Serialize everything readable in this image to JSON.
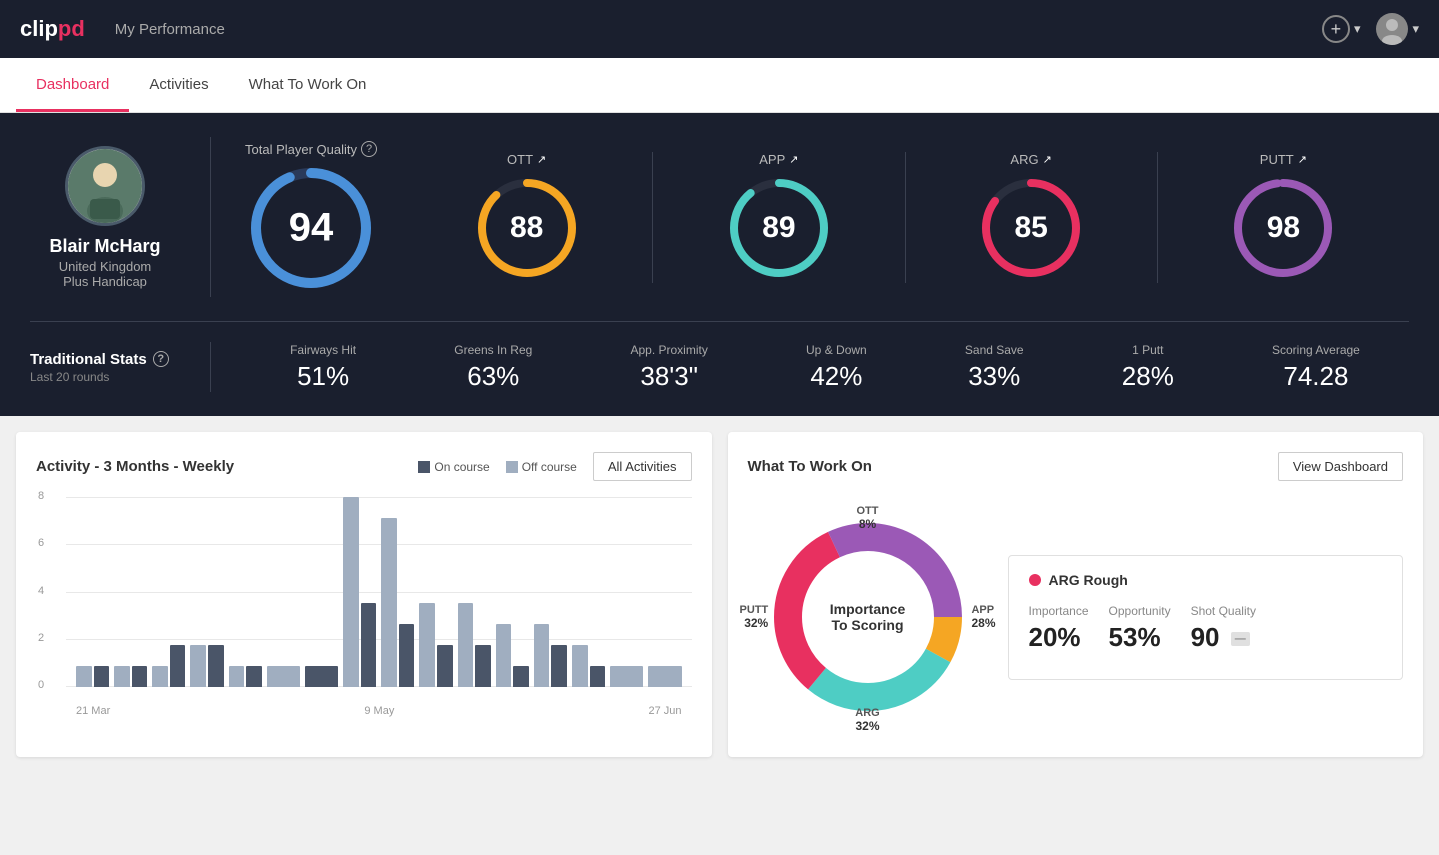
{
  "header": {
    "logo": "clippd",
    "logo_clip": "clip",
    "logo_pd": "pd",
    "title": "My Performance",
    "add_label": "+",
    "chevron": "▾"
  },
  "nav": {
    "tabs": [
      {
        "label": "Dashboard",
        "active": true
      },
      {
        "label": "Activities",
        "active": false
      },
      {
        "label": "What To Work On",
        "active": false
      }
    ]
  },
  "player": {
    "name": "Blair McHarg",
    "country": "United Kingdom",
    "handicap": "Plus Handicap"
  },
  "total_quality": {
    "label": "Total Player Quality",
    "value": 94,
    "pct": 94
  },
  "scores": [
    {
      "label": "OTT",
      "value": 88,
      "pct": 88,
      "color": "#f5a623",
      "track": "#2a2f3e"
    },
    {
      "label": "APP",
      "value": 89,
      "pct": 89,
      "color": "#4ecdc4",
      "track": "#2a2f3e"
    },
    {
      "label": "ARG",
      "value": 85,
      "pct": 85,
      "color": "#e83060",
      "track": "#2a2f3e"
    },
    {
      "label": "PUTT",
      "value": 98,
      "pct": 98,
      "color": "#9b59b6",
      "track": "#2a2f3e"
    }
  ],
  "trad_stats": {
    "title": "Traditional Stats",
    "subtitle": "Last 20 rounds",
    "items": [
      {
        "label": "Fairways Hit",
        "value": "51%"
      },
      {
        "label": "Greens In Reg",
        "value": "63%"
      },
      {
        "label": "App. Proximity",
        "value": "38'3\""
      },
      {
        "label": "Up & Down",
        "value": "42%"
      },
      {
        "label": "Sand Save",
        "value": "33%"
      },
      {
        "label": "1 Putt",
        "value": "28%"
      },
      {
        "label": "Scoring Average",
        "value": "74.28"
      }
    ]
  },
  "activity_chart": {
    "title": "Activity - 3 Months - Weekly",
    "legend_on": "On course",
    "legend_off": "Off course",
    "all_btn": "All Activities",
    "y_labels": [
      "8",
      "6",
      "4",
      "2",
      "0"
    ],
    "x_labels": [
      "21 Mar",
      "9 May",
      "27 Jun"
    ],
    "bars": [
      {
        "on": 1,
        "off": 1
      },
      {
        "on": 1,
        "off": 1
      },
      {
        "on": 2,
        "off": 1
      },
      {
        "on": 2,
        "off": 2
      },
      {
        "on": 1,
        "off": 1
      },
      {
        "on": 0,
        "off": 1
      },
      {
        "on": 1,
        "off": 0
      },
      {
        "on": 4,
        "off": 9
      },
      {
        "on": 3,
        "off": 8
      },
      {
        "on": 2,
        "off": 4
      },
      {
        "on": 2,
        "off": 4
      },
      {
        "on": 1,
        "off": 3
      },
      {
        "on": 2,
        "off": 3
      },
      {
        "on": 1,
        "off": 2
      },
      {
        "on": 0,
        "off": 1
      },
      {
        "on": 0,
        "off": 1
      }
    ]
  },
  "wtwo": {
    "title": "What To Work On",
    "view_btn": "View Dashboard",
    "donut_center": "Importance\nTo Scoring",
    "segments": [
      {
        "label": "OTT",
        "pct": "8%",
        "color": "#f5a623"
      },
      {
        "label": "APP",
        "pct": "28%",
        "color": "#4ecdc4"
      },
      {
        "label": "ARG",
        "pct": "32%",
        "color": "#e83060"
      },
      {
        "label": "PUTT",
        "pct": "32%",
        "color": "#9b59b6"
      }
    ],
    "card": {
      "title": "ARG Rough",
      "dot_color": "#e83060",
      "importance_label": "Importance",
      "importance_value": "20%",
      "opportunity_label": "Opportunity",
      "opportunity_value": "53%",
      "shot_quality_label": "Shot Quality",
      "shot_quality_value": "90"
    }
  }
}
